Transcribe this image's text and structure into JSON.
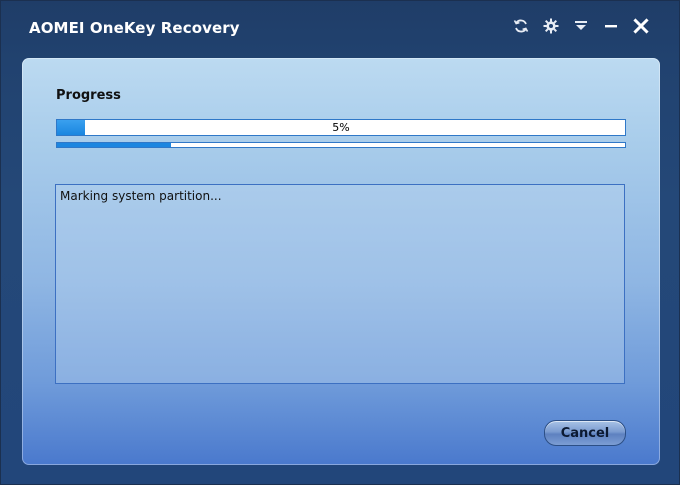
{
  "window": {
    "title": "AOMEI OneKey Recovery",
    "controls": [
      {
        "name": "refresh-icon"
      },
      {
        "name": "gear-icon"
      },
      {
        "name": "menu-dropdown-icon"
      },
      {
        "name": "minimize-icon"
      },
      {
        "name": "close-icon"
      }
    ]
  },
  "progress": {
    "label": "Progress",
    "percent_text": "5%",
    "percent": 5,
    "sub_progress_fraction": 0.2
  },
  "log": {
    "lines": [
      "Marking system partition..."
    ]
  },
  "buttons": {
    "cancel_label": "Cancel"
  },
  "colors": {
    "accent": "#1a86e0",
    "title_bar": "#21426f"
  }
}
